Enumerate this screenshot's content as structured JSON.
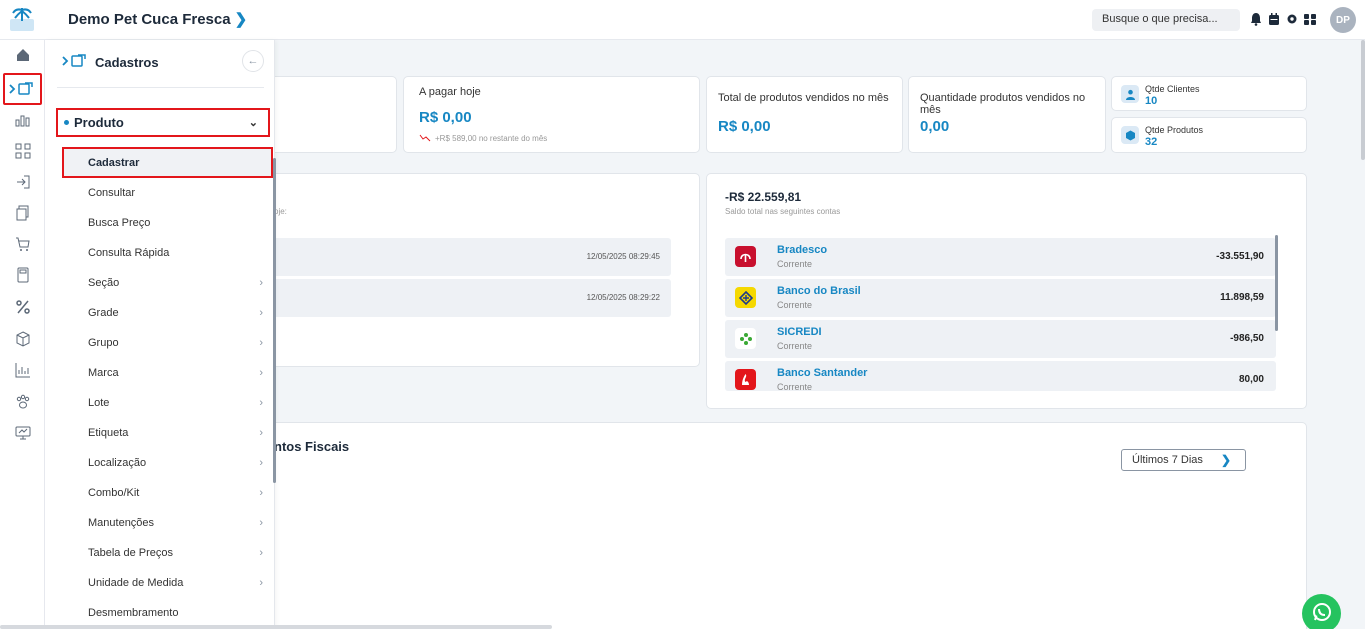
{
  "header": {
    "company": "Demo Pet Cuca Fresca",
    "search_placeholder": "Busque o que precisa...",
    "avatar_initials": "DP"
  },
  "rail": {
    "icons": [
      "home-icon",
      "cadastros-icon",
      "chart-icon",
      "qr-icon",
      "login-icon",
      "copy-icon",
      "cart-icon",
      "calculator-icon",
      "percent-icon",
      "box-icon",
      "report-icon",
      "paw-icon",
      "presentation-icon"
    ]
  },
  "submenu": {
    "title": "Cadastros",
    "section": "Produto",
    "items": [
      {
        "label": "Cadastrar",
        "has_arrow": false
      },
      {
        "label": "Consultar",
        "has_arrow": false
      },
      {
        "label": "Busca Preço",
        "has_arrow": false
      },
      {
        "label": "Consulta Rápida",
        "has_arrow": false
      },
      {
        "label": "Seção",
        "has_arrow": true
      },
      {
        "label": "Grade",
        "has_arrow": true
      },
      {
        "label": "Grupo",
        "has_arrow": true
      },
      {
        "label": "Marca",
        "has_arrow": true
      },
      {
        "label": "Lote",
        "has_arrow": true
      },
      {
        "label": "Etiqueta",
        "has_arrow": true
      },
      {
        "label": "Localização",
        "has_arrow": true
      },
      {
        "label": "Combo/Kit",
        "has_arrow": true
      },
      {
        "label": "Manutenções",
        "has_arrow": true
      },
      {
        "label": "Tabela de Preços",
        "has_arrow": true
      },
      {
        "label": "Unidade de Medida",
        "has_arrow": true
      },
      {
        "label": "Desmembramento",
        "has_arrow": false
      }
    ]
  },
  "stats": {
    "pay_today": {
      "label": "A pagar hoje",
      "value": "R$ 0,00",
      "note": "+R$ 589,00 no restante do mês"
    },
    "total_sold": {
      "label": "Total de produtos vendidos no mês",
      "value": "R$ 0,00"
    },
    "qty_sold": {
      "label": "Quantidade produtos vendidos no mês",
      "value": "0,00"
    },
    "clients": {
      "label": "Qtde Clientes",
      "value": "10"
    },
    "products": {
      "label": "Qtde Produtos",
      "value": "32"
    }
  },
  "activity": {
    "partial_label": "oje:",
    "rows": [
      {
        "time": "12/05/2025 08:29:45"
      },
      {
        "time": "12/05/2025 08:29:22"
      }
    ]
  },
  "balance": {
    "total": "-R$ 22.559,81",
    "caption": "Saldo total nas seguintes contas",
    "accounts": [
      {
        "name": "Bradesco",
        "type": "Corrente",
        "value": "-33.551,90",
        "color": "#c8102e",
        "glyph": "B"
      },
      {
        "name": "Banco do Brasil",
        "type": "Corrente",
        "value": "11.898,59",
        "color": "#f5d800",
        "glyph": "BB"
      },
      {
        "name": "SICREDI",
        "type": "Corrente",
        "value": "-986,50",
        "color": "#ffffff",
        "glyph": "✿"
      },
      {
        "name": "Banco Santander",
        "type": "Corrente",
        "value": "80,00",
        "color": "#e3161b",
        "glyph": "S"
      }
    ]
  },
  "fiscal": {
    "title_partial": "ntos Fiscais",
    "period_button": "Últimos 7 Dias"
  }
}
